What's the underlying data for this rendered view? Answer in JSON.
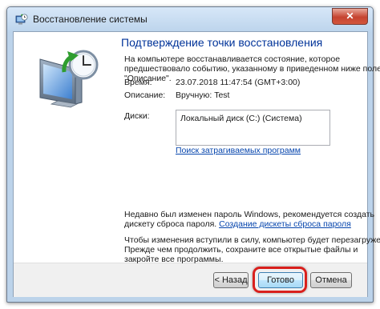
{
  "window": {
    "title": "Восстановление системы",
    "close_label": "✕"
  },
  "main": {
    "heading": "Подтверждение точки восстановления",
    "description_lines": [
      "На компьютере восстанавливается состояние, которое",
      "предшествовало событию, указанному в приведенном ниже поле",
      "\"Описание\"."
    ],
    "time_label": "Время:",
    "time_value": "23.07.2018 11:47:54 (GMT+3:00)",
    "description_label": "Описание:",
    "description_value": "Вручную: Test",
    "disks_label": "Диски:",
    "disks": [
      "Локальный диск (C:) (Система)"
    ],
    "scan_link": "Поиск затрагиваемых программ",
    "password_note_line1": "Недавно был изменен пароль Windows, рекомендуется создать",
    "password_note_prefix": "дискету сброса пароля.",
    "password_note_link": "Создание дискеты сброса пароля",
    "restart_note_lines": [
      "Чтобы изменения вступили в силу, компьютер будет перезагружен.",
      "Прежде чем продолжить, сохраните все открытые файлы и",
      "закройте все программы."
    ]
  },
  "buttons": {
    "back": "< Назад",
    "finish": "Готово",
    "cancel": "Отмена"
  },
  "icons": {
    "app": "system-restore-icon",
    "wizard": "system-restore-monitor-clock-icon"
  },
  "colors": {
    "heading": "#003399",
    "link": "#0645ad",
    "highlight": "#d9201d"
  }
}
